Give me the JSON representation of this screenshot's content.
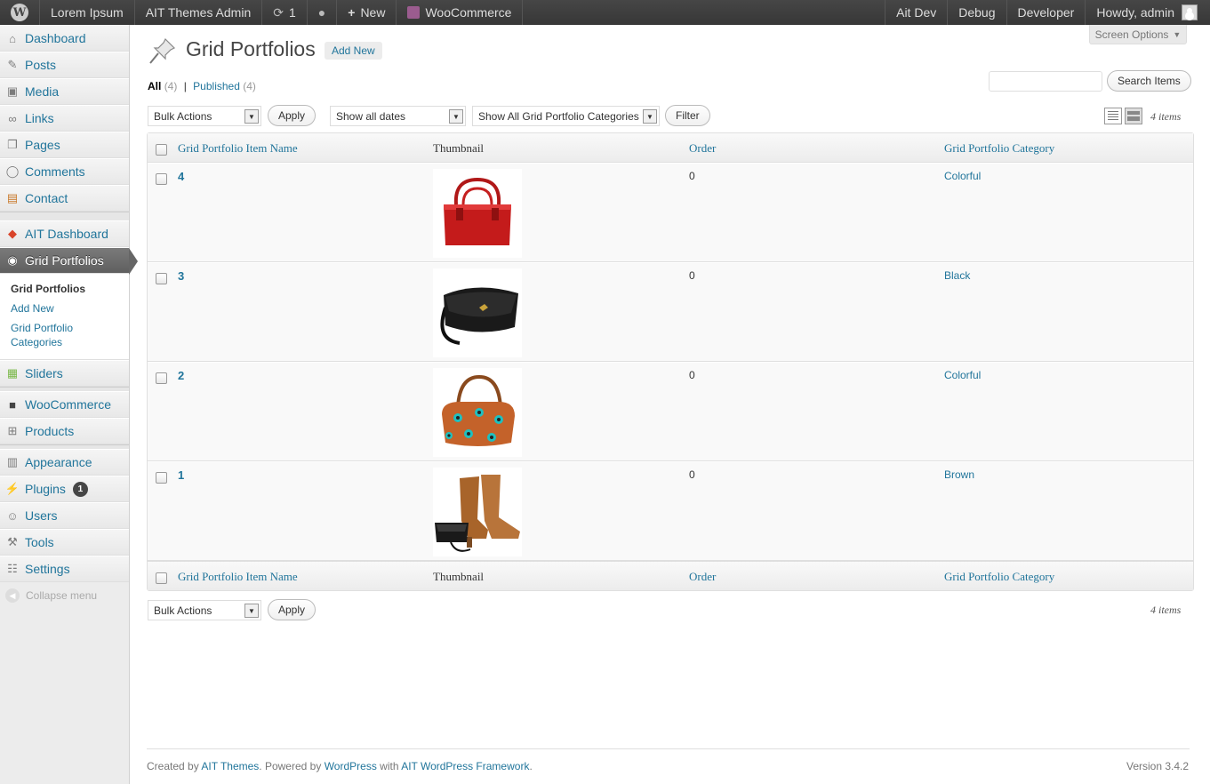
{
  "adminbar": {
    "site_name": "Lorem Ipsum",
    "admin_link": "AIT Themes Admin",
    "updates_count": "1",
    "new_label": "New",
    "woocommerce": "WooCommerce",
    "right_items": [
      "Ait Dev",
      "Debug",
      "Developer"
    ],
    "howdy": "Howdy, admin"
  },
  "sidebar": {
    "items": [
      {
        "label": "Dashboard",
        "icon": "dashboard-icon"
      },
      {
        "label": "Posts",
        "icon": "pushpin-icon"
      },
      {
        "label": "Media",
        "icon": "media-icon"
      },
      {
        "label": "Links",
        "icon": "link-icon"
      },
      {
        "label": "Pages",
        "icon": "pages-icon"
      },
      {
        "label": "Comments",
        "icon": "comment-icon"
      },
      {
        "label": "Contact",
        "icon": "contact-icon"
      },
      {
        "label": "AIT Dashboard",
        "icon": "ait-icon"
      },
      {
        "label": "Grid Portfolios",
        "icon": "portfolio-icon"
      },
      {
        "label": "Sliders",
        "icon": "slider-icon"
      },
      {
        "label": "WooCommerce",
        "icon": "woo-icon"
      },
      {
        "label": "Products",
        "icon": "cart-icon"
      },
      {
        "label": "Appearance",
        "icon": "appearance-icon"
      },
      {
        "label": "Plugins",
        "icon": "plugin-icon"
      },
      {
        "label": "Users",
        "icon": "users-icon"
      },
      {
        "label": "Tools",
        "icon": "tools-icon"
      },
      {
        "label": "Settings",
        "icon": "settings-icon"
      }
    ],
    "submenu": [
      "Grid Portfolios",
      "Add New",
      "Grid Portfolio Categories"
    ],
    "plugins_badge": "1",
    "collapse": "Collapse menu"
  },
  "screen_options": "Screen Options",
  "page": {
    "title": "Grid Portfolios",
    "add_new": "Add New"
  },
  "filters": {
    "all": "All",
    "all_count": "(4)",
    "published": "Published",
    "published_count": "(4)",
    "separator": "|"
  },
  "search": {
    "button": "Search Items",
    "placeholder": ""
  },
  "tablenav": {
    "bulk_actions": "Bulk Actions",
    "apply": "Apply",
    "dates": "Show all dates",
    "categories": "Show All Grid Portfolio Categories",
    "filter": "Filter",
    "items_count": "4 items"
  },
  "columns": [
    "Grid Portfolio Item Name",
    "Thumbnail",
    "Order",
    "Grid Portfolio Category"
  ],
  "rows": [
    {
      "name": "4",
      "order": "0",
      "category": "Colorful",
      "thumb": "red-handbag"
    },
    {
      "name": "3",
      "order": "0",
      "category": "Black",
      "thumb": "black-bag"
    },
    {
      "name": "2",
      "order": "0",
      "category": "Colorful",
      "thumb": "dotted-bag"
    },
    {
      "name": "1",
      "order": "0",
      "category": "Brown",
      "thumb": "brown-boots"
    }
  ],
  "footer": {
    "created_by": "Created by",
    "ait": "AIT Themes",
    "powered": ". Powered by",
    "wordpress": "WordPress",
    "with": "with",
    "framework": "AIT WordPress Framework",
    "end": ".",
    "version": "Version 3.4.2"
  },
  "colors": {
    "link": "#21759b",
    "adminbar": "#464646",
    "current_menu": "#6d6d6d"
  }
}
